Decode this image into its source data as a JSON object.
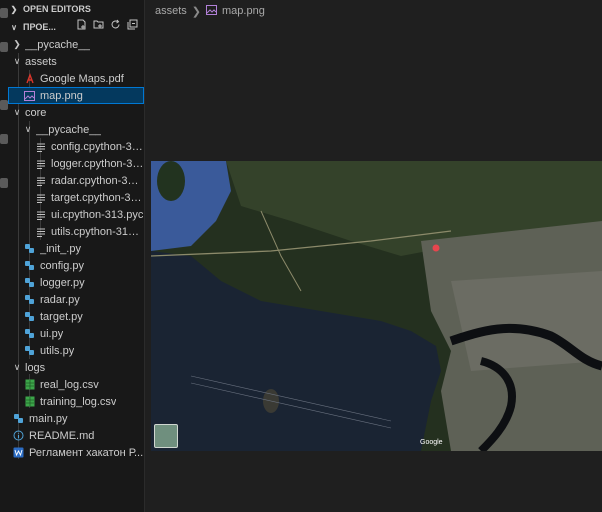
{
  "sidebar": {
    "open_editors_label": "OPEN EDITORS",
    "project_label": "ПРОЕ...",
    "tree": [
      {
        "label": "__pycache__",
        "type": "folder",
        "expanded": false,
        "depth": 1
      },
      {
        "label": "assets",
        "type": "folder",
        "expanded": true,
        "depth": 1
      },
      {
        "label": "Google Maps.pdf",
        "type": "pdf",
        "depth": 2
      },
      {
        "label": "map.png",
        "type": "image",
        "depth": 2,
        "selected": true
      },
      {
        "label": "core",
        "type": "folder",
        "expanded": true,
        "depth": 1
      },
      {
        "label": "__pycache__",
        "type": "folder",
        "expanded": true,
        "depth": 2
      },
      {
        "label": "config.cpython-31...",
        "type": "text",
        "depth": 3
      },
      {
        "label": "logger.cpython-31...",
        "type": "text",
        "depth": 3
      },
      {
        "label": "radar.cpython-313...",
        "type": "text",
        "depth": 3
      },
      {
        "label": "target.cpython-31...",
        "type": "text",
        "depth": 3
      },
      {
        "label": "ui.cpython-313.pyc",
        "type": "text",
        "depth": 3
      },
      {
        "label": "utils.cpython-313....",
        "type": "text",
        "depth": 3
      },
      {
        "label": "_init_.py",
        "type": "python",
        "depth": 2
      },
      {
        "label": "config.py",
        "type": "python",
        "depth": 2
      },
      {
        "label": "logger.py",
        "type": "python",
        "depth": 2
      },
      {
        "label": "radar.py",
        "type": "python",
        "depth": 2
      },
      {
        "label": "target.py",
        "type": "python",
        "depth": 2
      },
      {
        "label": "ui.py",
        "type": "python",
        "depth": 2
      },
      {
        "label": "utils.py",
        "type": "python",
        "depth": 2
      },
      {
        "label": "logs",
        "type": "folder",
        "expanded": true,
        "depth": 1
      },
      {
        "label": "real_log.csv",
        "type": "csv",
        "depth": 2
      },
      {
        "label": "training_log.csv",
        "type": "csv",
        "depth": 2
      },
      {
        "label": "main.py",
        "type": "python",
        "depth": 1
      },
      {
        "label": "README.md",
        "type": "info",
        "depth": 1
      },
      {
        "label": "Регламент хакатон Р...",
        "type": "word",
        "depth": 1
      }
    ]
  },
  "editor": {
    "breadcrumb": [
      "assets",
      "map.png"
    ],
    "map": {
      "attribution": "Google"
    }
  },
  "colors": {
    "selection_bg": "#04395e",
    "selection_border": "#0078d4",
    "python_icon": "#4fa3d8",
    "csv_icon": "#3ca64a",
    "pdf_icon": "#d9362b",
    "image_icon": "#b180d7"
  },
  "icons": {
    "folder_closed": "chevron-right-icon",
    "folder_open": "chevron-down-icon",
    "new_file": "new-file-icon",
    "new_folder": "new-folder-icon",
    "refresh": "refresh-icon",
    "collapse": "collapse-all-icon"
  }
}
